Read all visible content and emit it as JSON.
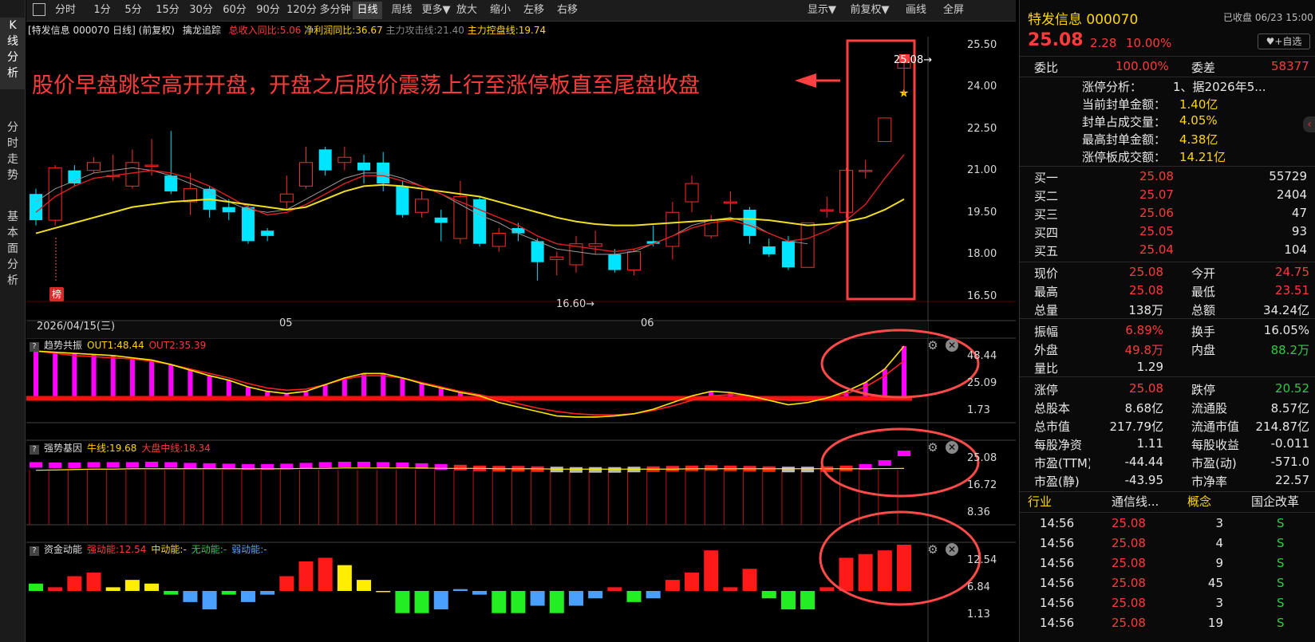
{
  "nav": {
    "kline": "K线分析",
    "intraday": "分时走势",
    "fundamental": "基本面分析"
  },
  "toolbar": {
    "periods": [
      "分时",
      "1分",
      "5分",
      "15分",
      "30分",
      "60分",
      "90分",
      "120分",
      "多分钟",
      "日线",
      "周线",
      "更多▼"
    ],
    "actions": [
      "放大",
      "缩小",
      "左移",
      "右移"
    ],
    "right": [
      "显示▼",
      "前复权▼",
      "画线",
      "全屏"
    ]
  },
  "infobar": {
    "stock": "[特发信息 000070 日线] (前复权)",
    "indicator": "擒龙追踪",
    "revenue": "总收入同比:5.06",
    "profit": "净利润同比:36.67",
    "attack": "主力攻击线:21.40",
    "control": "主力控盘线:19.74"
  },
  "annotation": "股价早盘跳空高开开盘，开盘之后股价震荡上行至涨停板直至尾盘收盘",
  "main_chart": {
    "y_ticks": [
      "25.50",
      "24.00",
      "22.50",
      "21.00",
      "19.50",
      "18.00",
      "16.50"
    ],
    "date_label": "2026/04/15(三)",
    "month_labels": [
      "05",
      "06"
    ],
    "low_label": "16.60",
    "last_label": "25.08",
    "badge": "榜"
  },
  "panels": [
    {
      "name": "趋势共振",
      "vals": [
        {
          "t": "OUT1:48.44",
          "c": "#ffd700"
        },
        {
          "t": "OUT2:35.39",
          "c": "#ff3b3b"
        }
      ],
      "ticks": [
        "48.44",
        "25.09",
        "1.73"
      ]
    },
    {
      "name": "强势基因",
      "vals": [
        {
          "t": "牛线:19.68",
          "c": "#ffd700"
        },
        {
          "t": "大盘中线:18.34",
          "c": "#ff3b3b"
        }
      ],
      "ticks": [
        "25.08",
        "16.72",
        "8.36"
      ]
    },
    {
      "name": "资金动能",
      "vals": [
        {
          "t": "强动能:12.54",
          "c": "#ff3b3b"
        },
        {
          "t": "中动能:-",
          "c": "#ffd700"
        },
        {
          "t": "无动能:-",
          "c": "#2ecc40"
        },
        {
          "t": "弱动能:-",
          "c": "#5aa0ff"
        }
      ],
      "ticks": [
        "12.54",
        "6.84",
        "1.13"
      ]
    }
  ],
  "chart_data": {
    "type": "candlestick",
    "ylim": [
      15.8,
      25.9
    ],
    "candles": [
      [
        19.9,
        18.9,
        20.1,
        18.7
      ],
      [
        18.9,
        20.9,
        21.0,
        18.7
      ],
      [
        20.8,
        20.3,
        21.0,
        20.2
      ],
      [
        20.8,
        21.1,
        21.3,
        20.7
      ],
      [
        20.6,
        20.6,
        21.4,
        20.4
      ],
      [
        20.2,
        21.1,
        21.6,
        20.1
      ],
      [
        21.0,
        21.0,
        22.0,
        20.6
      ],
      [
        20.6,
        20.0,
        22.3,
        19.9
      ],
      [
        19.6,
        20.1,
        20.7,
        19.1
      ],
      [
        20.1,
        19.3,
        20.2,
        19.0
      ],
      [
        19.4,
        19.2,
        19.7,
        18.9
      ],
      [
        19.4,
        18.1,
        19.5,
        18.0
      ],
      [
        18.5,
        18.3,
        18.6,
        18.1
      ],
      [
        19.6,
        19.9,
        20.6,
        19.3
      ],
      [
        20.2,
        21.1,
        21.7,
        20.1
      ],
      [
        21.6,
        20.8,
        21.7,
        20.6
      ],
      [
        21.1,
        21.3,
        21.7,
        20.8
      ],
      [
        21.1,
        20.8,
        21.4,
        20.3
      ],
      [
        21.1,
        20.3,
        21.5,
        20.0
      ],
      [
        20.2,
        19.1,
        20.4,
        19.0
      ],
      [
        19.2,
        19.7,
        20.0,
        19.0
      ],
      [
        19.0,
        18.8,
        19.3,
        18.1
      ],
      [
        18.2,
        19.8,
        20.4,
        18.0
      ],
      [
        19.7,
        18.0,
        19.8,
        17.9
      ],
      [
        17.9,
        18.4,
        18.6,
        17.7
      ],
      [
        18.6,
        18.4,
        18.8,
        18.1
      ],
      [
        18.1,
        17.3,
        18.2,
        16.6
      ],
      [
        17.4,
        17.5,
        17.7,
        16.8
      ],
      [
        17.2,
        18.0,
        18.3,
        16.9
      ],
      [
        17.9,
        18.0,
        18.5,
        17.6
      ],
      [
        17.6,
        17.0,
        17.8,
        16.9
      ],
      [
        17.0,
        17.7,
        17.8,
        16.8
      ],
      [
        18.1,
        18.0,
        18.7,
        17.9
      ],
      [
        17.9,
        19.2,
        19.6,
        17.4
      ],
      [
        19.6,
        20.3,
        20.6,
        19.2
      ],
      [
        18.3,
        18.9,
        19.1,
        18.2
      ],
      [
        19.6,
        19.6,
        20.0,
        19.2
      ],
      [
        19.3,
        18.3,
        19.4,
        18.0
      ],
      [
        17.9,
        17.6,
        18.2,
        17.5
      ],
      [
        18.1,
        17.1,
        18.3,
        17.0
      ],
      [
        17.1,
        18.8,
        18.8,
        17.1
      ],
      [
        19.3,
        19.3,
        19.8,
        19.0
      ],
      [
        19.2,
        20.8,
        20.9,
        19.0
      ],
      [
        20.8,
        20.8,
        21.2,
        20.5
      ],
      [
        21.9,
        22.8,
        22.8,
        21.9
      ],
      [
        24.7,
        25.1,
        25.1,
        24.7
      ]
    ],
    "ma_yellow": [
      18.4,
      18.6,
      18.8,
      19.0,
      19.2,
      19.4,
      19.5,
      19.6,
      19.65,
      19.7,
      19.6,
      19.5,
      19.4,
      19.3,
      19.4,
      19.7,
      20.0,
      20.2,
      20.25,
      20.2,
      20.1,
      20.0,
      19.9,
      19.8,
      19.6,
      19.4,
      19.2,
      19.0,
      18.85,
      18.75,
      18.7,
      18.7,
      18.75,
      18.8,
      18.85,
      18.9,
      18.95,
      18.95,
      18.9,
      18.8,
      18.7,
      18.75,
      18.85,
      19.0,
      19.3,
      19.7
    ],
    "ma_red": [
      19.2,
      19.8,
      20.2,
      20.5,
      20.6,
      20.7,
      20.8,
      20.7,
      20.5,
      20.2,
      19.8,
      19.4,
      19.1,
      19.2,
      19.5,
      19.9,
      20.3,
      20.6,
      20.6,
      20.4,
      20.2,
      19.9,
      19.6,
      19.3,
      19.0,
      18.7,
      18.3,
      18.0,
      17.9,
      17.8,
      17.7,
      17.8,
      18.0,
      18.3,
      18.6,
      18.8,
      18.9,
      18.7,
      18.4,
      18.1,
      18.2,
      18.5,
      18.9,
      19.5,
      20.5,
      21.4
    ],
    "ma_gray": [
      19.6,
      20.1,
      20.4,
      20.7,
      20.8,
      20.9,
      20.8,
      20.6,
      20.3,
      20.0,
      19.6,
      19.3,
      19.2,
      19.3,
      19.7,
      20.1,
      20.5,
      20.7,
      20.7,
      20.5,
      20.2,
      19.9,
      19.5,
      19.1,
      18.8,
      18.4,
      18.1,
      17.8,
      17.7,
      17.6,
      17.6,
      17.7,
      18.0,
      18.3,
      18.7,
      18.9,
      19.0,
      18.8,
      18.4,
      18.1,
      18.0
    ],
    "trend_out1": [
      44,
      43,
      42,
      41,
      40,
      38,
      36,
      32,
      27,
      22,
      18,
      12,
      8,
      6,
      8,
      14,
      20,
      24,
      24,
      20,
      15,
      11,
      7,
      4,
      -2,
      -6,
      -10,
      -14,
      -15,
      -15,
      -14,
      -12,
      -8,
      -2,
      4,
      8,
      7,
      4,
      0,
      -4,
      -2,
      2,
      8,
      16,
      28,
      48.44
    ],
    "trend_out2": [
      44,
      42,
      40,
      39,
      38,
      37,
      35,
      32,
      28,
      24,
      20,
      15,
      11,
      9,
      10,
      14,
      19,
      22,
      22,
      20,
      16,
      12,
      8,
      5,
      1,
      -3,
      -7,
      -10,
      -12,
      -13,
      -13,
      -12,
      -9,
      -5,
      0,
      4,
      5,
      4,
      2,
      0,
      0,
      2,
      6,
      12,
      22,
      35.39
    ],
    "gene_bars": [
      20.5,
      20.4,
      20.4,
      20.5,
      20.5,
      20.5,
      20.6,
      20.5,
      20.3,
      20.2,
      20.1,
      20.0,
      20.0,
      20.1,
      20.3,
      20.5,
      20.6,
      20.6,
      20.5,
      20.4,
      20.2,
      20.0,
      19.8,
      19.6,
      19.5,
      19.5,
      19.4,
      19.3,
      19.2,
      19.2,
      19.2,
      19.3,
      19.4,
      19.5,
      19.6,
      19.7,
      19.6,
      19.5,
      19.4,
      19.3,
      19.3,
      19.4,
      19.6,
      20.0,
      21.0,
      23.5
    ],
    "gene_line": [
      19.2,
      19.3,
      19.4,
      19.5,
      19.5,
      19.6,
      19.6,
      19.6,
      19.6,
      19.6,
      19.6,
      19.6,
      19.6,
      19.6,
      19.7,
      19.7,
      19.8,
      19.8,
      19.8,
      19.8,
      19.8,
      19.7,
      19.7,
      19.7,
      19.6,
      19.6,
      19.6,
      19.5,
      19.5,
      19.5,
      19.5,
      19.5,
      19.5,
      19.5,
      19.6,
      19.6,
      19.6,
      19.6,
      19.6,
      19.6,
      19.6,
      19.6,
      19.6,
      19.6,
      19.65,
      19.68
    ],
    "money_flow": [
      2,
      1,
      4,
      5,
      1,
      3,
      2,
      -1,
      -3,
      -5,
      -1,
      -3,
      -1,
      4,
      8,
      9,
      7,
      3,
      0,
      -6,
      -6,
      -5,
      0.5,
      -1,
      -6,
      -6,
      -4,
      -6,
      -4,
      -2,
      1,
      -3,
      -2,
      3,
      5,
      11,
      1,
      6,
      -2,
      -5,
      -5,
      1,
      9,
      10,
      11,
      12.54
    ],
    "money_colors": [
      "g",
      "r",
      "r",
      "r",
      "y",
      "y",
      "y",
      "g",
      "b",
      "b",
      "g",
      "b",
      "b",
      "r",
      "r",
      "r",
      "y",
      "y",
      "y",
      "g",
      "g",
      "b",
      "b",
      "b",
      "g",
      "g",
      "b",
      "g",
      "b",
      "b",
      "r",
      "g",
      "b",
      "r",
      "r",
      "r",
      "r",
      "r",
      "g",
      "g",
      "g",
      "r",
      "r",
      "r",
      "r",
      "r"
    ]
  },
  "quote": {
    "name": "特发信息 000070",
    "status": "已收盘 06/23 15:00",
    "price": "25.08",
    "change": "2.28",
    "pct": "10.00%",
    "watch": "+自选",
    "weibi_label": "委比",
    "weibi": "100.00%",
    "weicha_label": "委差",
    "weicha": "58377",
    "limit": [
      {
        "k": "涨停分析：",
        "v": "1、据2026年5..."
      },
      {
        "k": "当前封单金额：",
        "v": "1.40亿"
      },
      {
        "k": "封单占成交量：",
        "v": "4.05%"
      },
      {
        "k": "最高封单金额：",
        "v": "4.38亿"
      },
      {
        "k": "涨停板成交额：",
        "v": "14.21亿"
      }
    ],
    "bids": [
      {
        "l": "买一",
        "p": "25.08",
        "v": "55729"
      },
      {
        "l": "买二",
        "p": "25.07",
        "v": "2404"
      },
      {
        "l": "买三",
        "p": "25.06",
        "v": "47"
      },
      {
        "l": "买四",
        "p": "25.05",
        "v": "93"
      },
      {
        "l": "买五",
        "p": "25.04",
        "v": "104"
      }
    ],
    "stats": [
      {
        "k1": "现价",
        "v1": "25.08",
        "c1": "red",
        "k2": "今开",
        "v2": "24.75",
        "c2": "red"
      },
      {
        "k1": "最高",
        "v1": "25.08",
        "c1": "red",
        "k2": "最低",
        "v2": "23.51",
        "c2": "red"
      },
      {
        "k1": "总量",
        "v1": "138万",
        "c1": "white",
        "k2": "总额",
        "v2": "34.24亿",
        "c2": "white"
      },
      {
        "k1": "振幅",
        "v1": "6.89%",
        "c1": "red",
        "k2": "换手",
        "v2": "16.05%",
        "c2": "white"
      },
      {
        "k1": "外盘",
        "v1": "49.8万",
        "c1": "red",
        "k2": "内盘",
        "v2": "88.2万",
        "c2": "green"
      },
      {
        "k1": "量比",
        "v1": "1.29",
        "c1": "white",
        "k2": "",
        "v2": "",
        "c2": "white"
      },
      {
        "k1": "涨停",
        "v1": "25.08",
        "c1": "red",
        "k2": "跌停",
        "v2": "20.52",
        "c2": "green"
      },
      {
        "k1": "总股本",
        "v1": "8.68亿",
        "c1": "white",
        "k2": "流通股",
        "v2": "8.57亿",
        "c2": "white"
      },
      {
        "k1": "总市值",
        "v1": "217.79亿",
        "c1": "white",
        "k2": "流通市值",
        "v2": "214.87亿",
        "c2": "white"
      },
      {
        "k1": "每股净资",
        "v1": "1.11",
        "c1": "white",
        "k2": "每股收益",
        "v2": "-0.011",
        "c2": "white"
      },
      {
        "k1": "市盈(TTM)",
        "v1": "-44.44",
        "c1": "white",
        "k2": "市盈(动)",
        "v2": "-571.0",
        "c2": "white"
      },
      {
        "k1": "市盈(静)",
        "v1": "-43.95",
        "c1": "white",
        "k2": "市净率",
        "v2": "22.57",
        "c2": "white"
      }
    ],
    "industry_label": "行业",
    "industry": "通信线...",
    "concept_label": "概念",
    "concept": "国企改革",
    "ticks": [
      {
        "t": "14:56",
        "p": "25.08",
        "v": "3",
        "s": "S"
      },
      {
        "t": "14:56",
        "p": "25.08",
        "v": "4",
        "s": "S"
      },
      {
        "t": "14:56",
        "p": "25.08",
        "v": "9",
        "s": "S"
      },
      {
        "t": "14:56",
        "p": "25.08",
        "v": "45",
        "s": "S"
      },
      {
        "t": "14:56",
        "p": "25.08",
        "v": "3",
        "s": "S"
      },
      {
        "t": "14:56",
        "p": "25.08",
        "v": "19",
        "s": "S"
      }
    ]
  }
}
